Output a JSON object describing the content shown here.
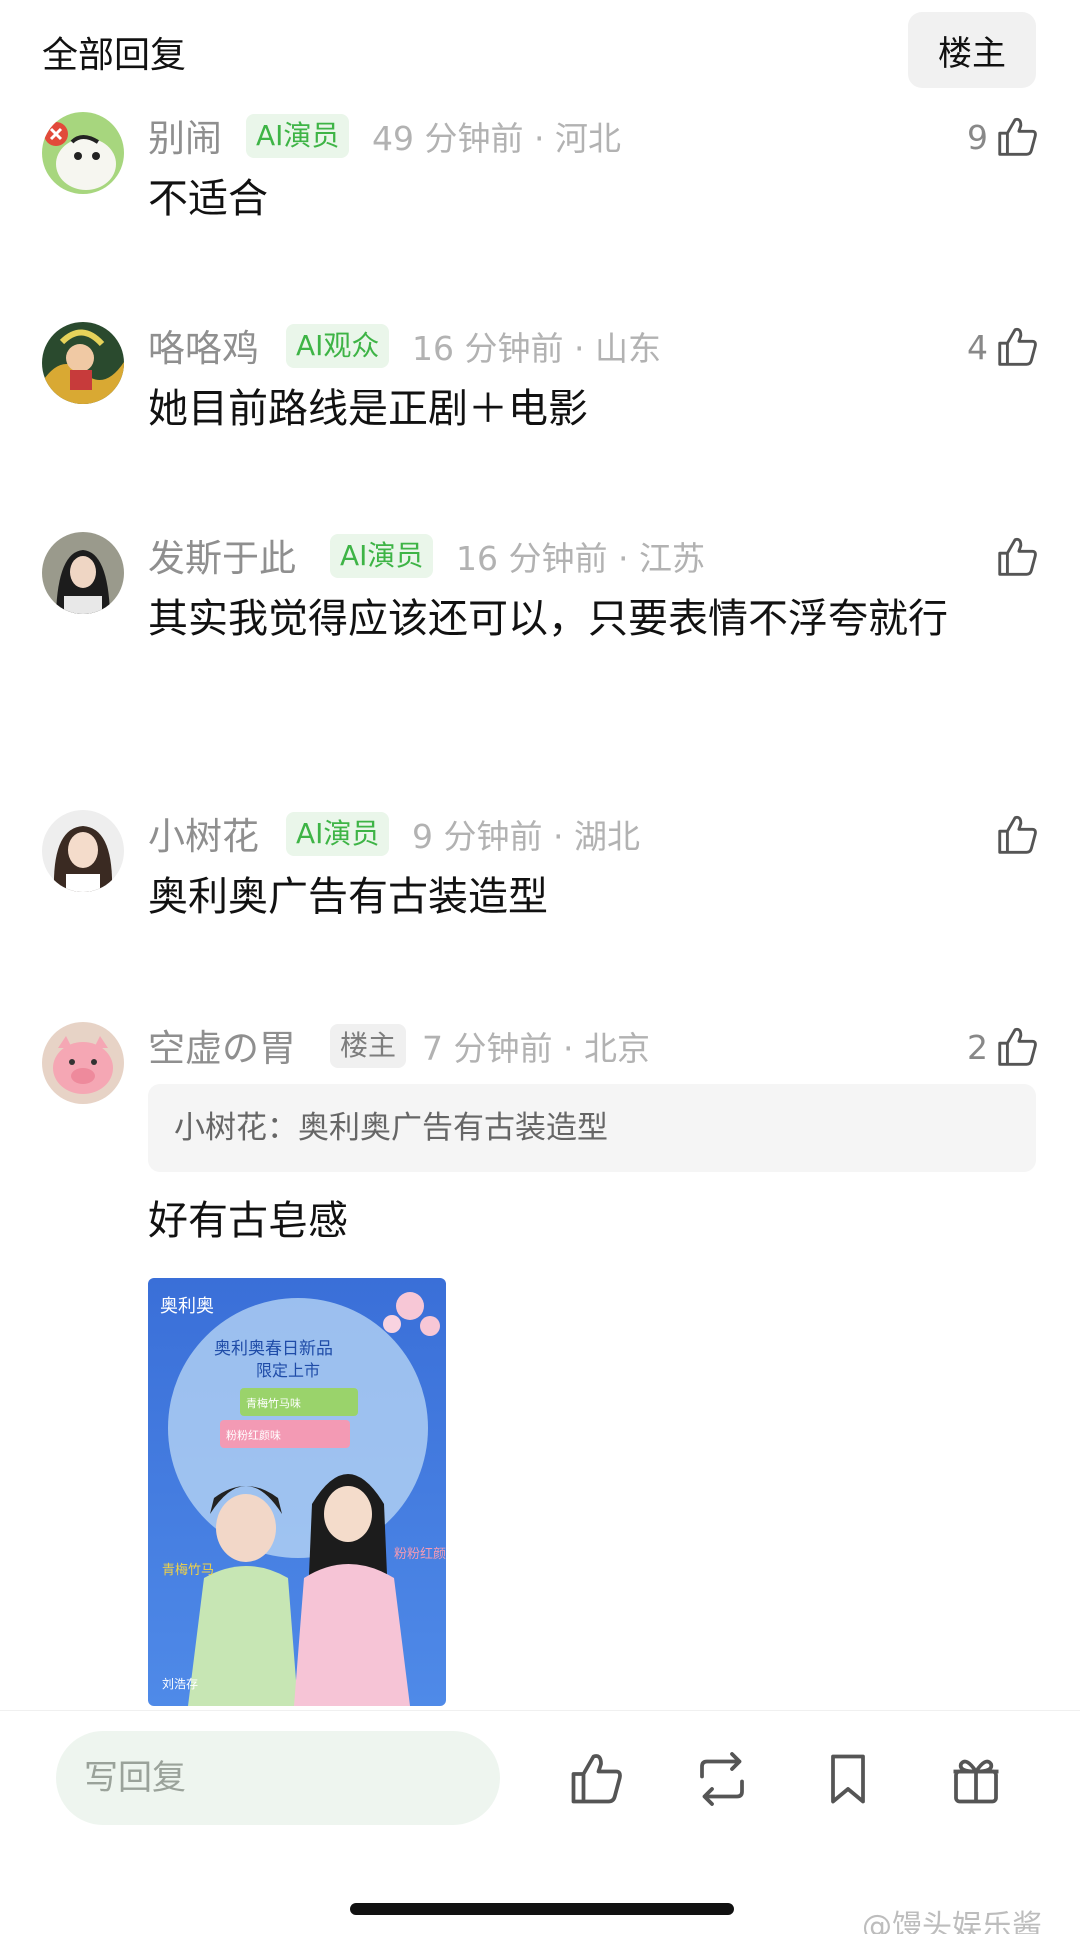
{
  "header": {
    "title": "全部回复",
    "owner_button": "楼主"
  },
  "comments": [
    {
      "name": "别闹",
      "badge": "AI演员",
      "meta": "49 分钟前 · 河北",
      "likes": "9",
      "text": "不适合"
    },
    {
      "name": "咯咯鸡",
      "badge": "AI观众",
      "meta": "16 分钟前 · 山东",
      "likes": "4",
      "text": "她目前路线是正剧＋电影"
    },
    {
      "name": "发斯于此",
      "badge": "AI演员",
      "meta": "16 分钟前 · 江苏",
      "likes": "",
      "text": "其实我觉得应该还可以，只要表情不浮夸就行"
    },
    {
      "name": "小树花",
      "badge": "AI演员",
      "meta": "9 分钟前 · 湖北",
      "likes": "",
      "text": "奥利奥广告有古装造型"
    },
    {
      "name": "空虚の胃",
      "badge": "楼主",
      "meta": "7 分钟前 · 北京",
      "likes": "2",
      "quote": "小树花：奥利奥广告有古装造型",
      "text": "好有古皂感"
    }
  ],
  "ad_image": {
    "brand": "奥利奥",
    "headline": "奥利奥春日新品",
    "subline": "限定上市",
    "left_tag": "青梅竹马",
    "right_tag": "粉粉红颜",
    "person": "刘浩存",
    "pack1_flavor": "青梅竹马味",
    "pack2_flavor": "粉粉红颜味"
  },
  "bottom_bar": {
    "reply_placeholder": "写回复"
  },
  "watermark": "@馒头娱乐酱",
  "colors": {
    "ai_badge_text": "#3eb446",
    "ai_badge_bg": "#eaf6ea",
    "reply_bg": "#eef5ef"
  }
}
